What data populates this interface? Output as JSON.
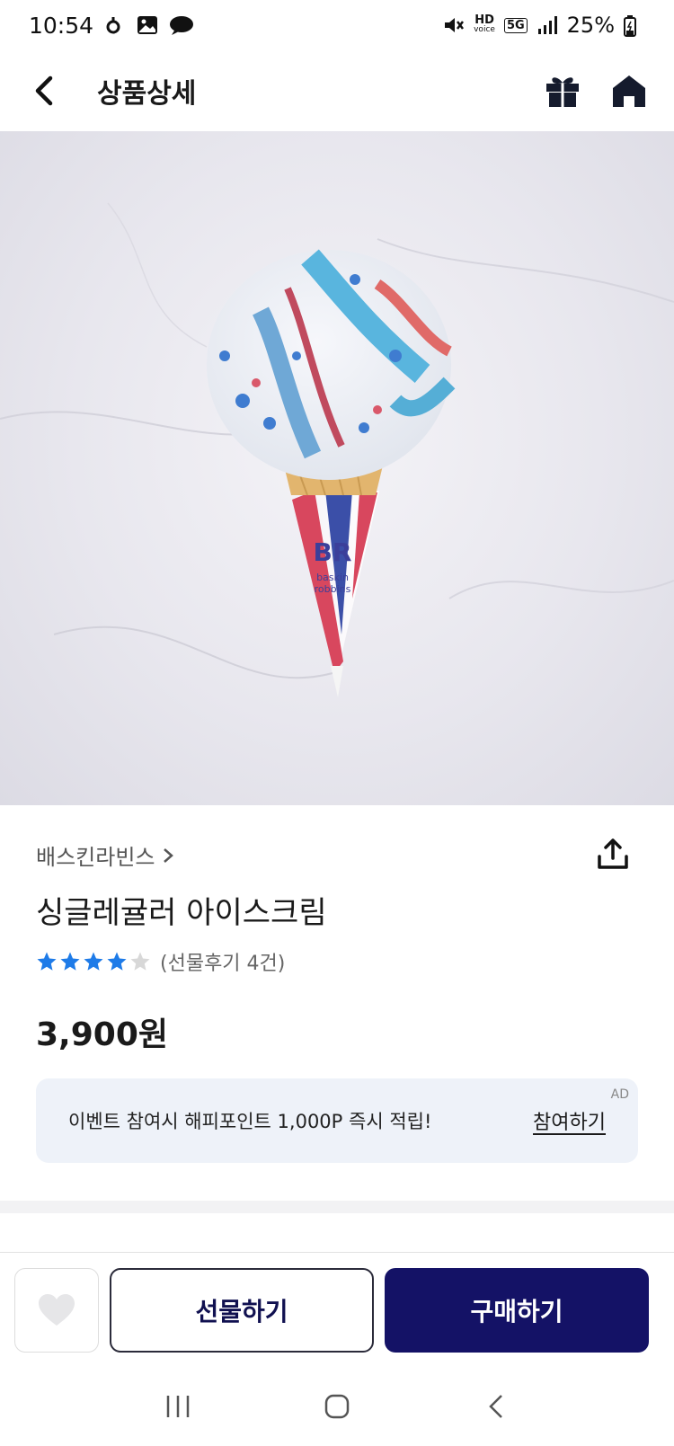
{
  "status_bar": {
    "time": "10:54",
    "hd_label": "HD",
    "hd_sub": "voice",
    "network": "5G",
    "battery": "25%",
    "icons": [
      "notification-dot-icon",
      "gallery-icon",
      "chat-icon",
      "mute-icon",
      "signal-icon",
      "battery-icon"
    ]
  },
  "header": {
    "title": "상품상세",
    "icons": [
      "back-arrow-icon",
      "gift-box-icon",
      "home-icon"
    ]
  },
  "product": {
    "brand": "배스킨라빈스",
    "name": "싱글레귤러 아이스크림",
    "rating": 4,
    "rating_max": 5,
    "review_count": "(선물후기 4건)",
    "price": "3,900원",
    "image_alt": "icon-ice-cream-cone"
  },
  "ad": {
    "text": "이벤트 참여시 해피포인트 1,000P 즉시 적립!",
    "link": "참여하기",
    "tag": "AD"
  },
  "actions": {
    "gift_label": "선물하기",
    "buy_label": "구매하기"
  },
  "colors": {
    "accent": "#141266",
    "star_filled": "#1e7be8",
    "star_empty": "#d8d8d8",
    "ad_bg": "#eef2f9"
  }
}
